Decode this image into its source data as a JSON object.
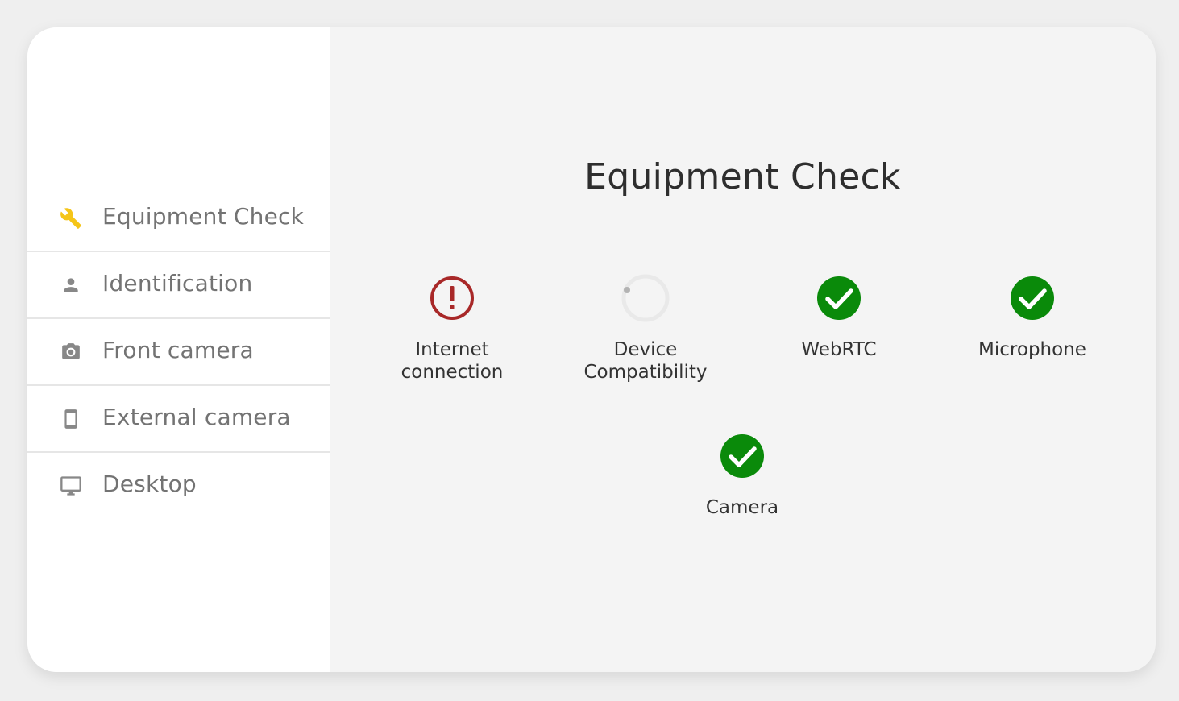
{
  "sidebar": {
    "items": [
      {
        "label": "Equipment Check",
        "icon": "wrench-icon"
      },
      {
        "label": "Identification",
        "icon": "person-icon"
      },
      {
        "label": "Front camera",
        "icon": "camera-icon"
      },
      {
        "label": "External camera",
        "icon": "smartphone-icon"
      },
      {
        "label": "Desktop",
        "icon": "monitor-icon"
      }
    ]
  },
  "main": {
    "title": "Equipment Check",
    "checks": [
      {
        "label": "Internet\nconnection",
        "status": "error",
        "icon": "error-icon"
      },
      {
        "label": "Device\nCompatibility",
        "status": "loading",
        "icon": "spinner-icon"
      },
      {
        "label": "WebRTC",
        "status": "success",
        "icon": "check-circle-icon"
      },
      {
        "label": "Microphone",
        "status": "success",
        "icon": "check-circle-icon"
      },
      {
        "label": "Camera",
        "status": "success",
        "icon": "check-circle-icon"
      }
    ]
  },
  "colors": {
    "accent": "#f5c518",
    "success": "#0a8a0a",
    "error": "#a82828",
    "sidebar_text": "#737373",
    "title_text": "#2e2e2e"
  }
}
